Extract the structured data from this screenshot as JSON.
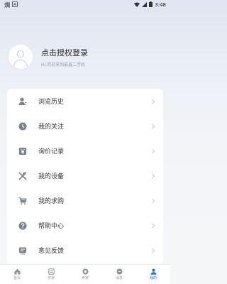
{
  "status_bar": {
    "time": "3:48",
    "left_glyphs": [
      "爛",
      "A"
    ]
  },
  "profile": {
    "login_label": "点击授权登录",
    "welcome_text": "Hi,欢迎来到最鑫二手机"
  },
  "menu": [
    {
      "label": "浏览历史",
      "icon": "history-icon"
    },
    {
      "label": "我的关注",
      "icon": "clock-follow-icon"
    },
    {
      "label": "询价记录",
      "icon": "quote-icon"
    },
    {
      "label": "我的设备",
      "icon": "tools-icon"
    },
    {
      "label": "我的求购",
      "icon": "cart-icon"
    },
    {
      "label": "帮助中心",
      "icon": "help-icon"
    },
    {
      "label": "意见反馈",
      "icon": "feedback-icon"
    }
  ],
  "tabs": [
    {
      "label": "首页",
      "active": false
    },
    {
      "label": "买家",
      "active": false
    },
    {
      "label": "卖家",
      "active": false
    },
    {
      "label": "消息",
      "active": false
    },
    {
      "label": "我的",
      "active": true
    }
  ],
  "colors": {
    "accent": "#2f6fe6",
    "icon_gray": "#7a828e"
  }
}
